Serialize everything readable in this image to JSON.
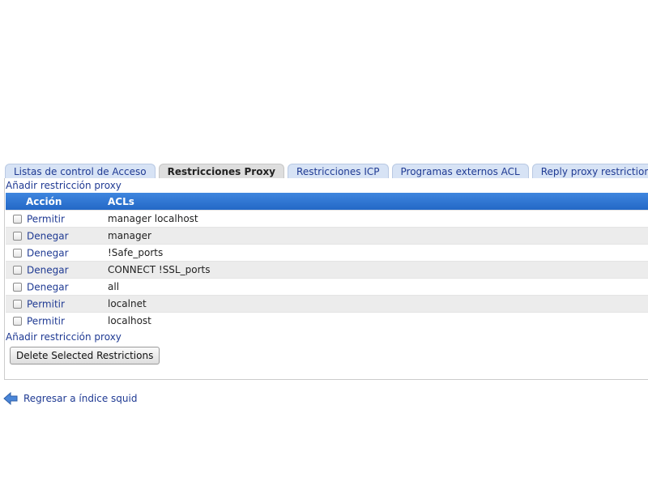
{
  "tabs": [
    {
      "label": "Listas de control de Acceso",
      "active": false
    },
    {
      "label": "Restricciones Proxy",
      "active": true
    },
    {
      "label": "Restricciones ICP",
      "active": false
    },
    {
      "label": "Programas externos ACL",
      "active": false
    },
    {
      "label": "Reply proxy restrictions",
      "active": false
    }
  ],
  "panel": {
    "add_link_top": "Añadir restricción proxy",
    "add_link_bottom": "Añadir restricción proxy",
    "table": {
      "headers": {
        "action": "Acción",
        "acls": "ACLs"
      },
      "rows": [
        {
          "action": "Permitir",
          "acls": "manager localhost",
          "checked": false
        },
        {
          "action": "Denegar",
          "acls": "manager",
          "checked": false
        },
        {
          "action": "Denegar",
          "acls": "!Safe_ports",
          "checked": false
        },
        {
          "action": "Denegar",
          "acls": "CONNECT !SSL_ports",
          "checked": false
        },
        {
          "action": "Denegar",
          "acls": "all",
          "checked": false
        },
        {
          "action": "Permitir",
          "acls": "localnet",
          "checked": false
        },
        {
          "action": "Permitir",
          "acls": "localhost",
          "checked": false
        }
      ]
    },
    "delete_button": "Delete Selected Restrictions"
  },
  "footer": {
    "return_icon": "back-arrow-icon",
    "return_link": "Regresar a índice squid"
  },
  "colors": {
    "header_blue": "#2f77d6",
    "link_blue": "#1f3a93",
    "tab_bg": "#d7e3f5",
    "active_tab_bg": "#dedede",
    "row_alt": "#ececec"
  }
}
